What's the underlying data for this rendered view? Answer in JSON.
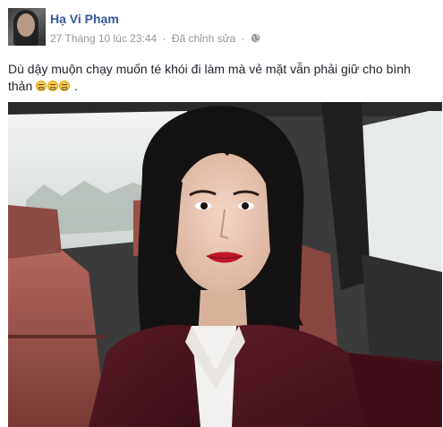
{
  "post": {
    "author_name": "Hạ Vi Phạm",
    "timestamp": "27 Tháng 10 lúc 23:44",
    "separator": "·",
    "edited_label": "Đã chỉnh sửa",
    "privacy_icon": "globe-icon",
    "text": "Dù dậy muộn chạy muốn té khói đi làm mà vẻ mặt vẫn phải giữ cho bình thản",
    "emoji_icon": "grimacing-face-icon",
    "emoji_count": 3,
    "text_end": "."
  },
  "colors": {
    "name_link": "#365899",
    "meta_text": "#90949c",
    "body_text": "#1d2129"
  }
}
